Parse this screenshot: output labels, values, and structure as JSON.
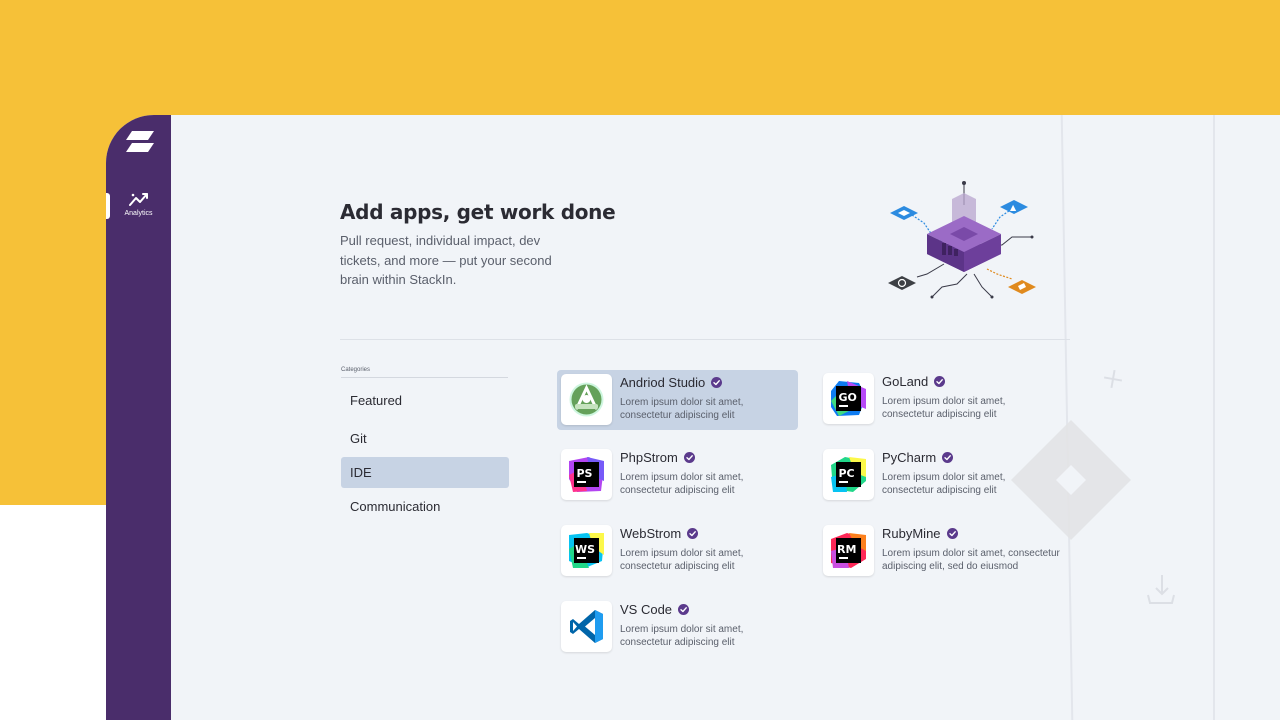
{
  "sidebar": {
    "nav": [
      {
        "label": "Analytics",
        "icon": "analytics-icon"
      }
    ]
  },
  "hero": {
    "title": "Add apps, get work done",
    "subtitle": "Pull request, individual impact, dev tickets, and more — put your second brain within StackIn."
  },
  "categories": {
    "label": "Categories",
    "items": [
      {
        "label": "Featured",
        "active": false
      },
      {
        "label": "Git",
        "active": false
      },
      {
        "label": "IDE",
        "active": true
      },
      {
        "label": "Communication",
        "active": false
      }
    ]
  },
  "apps": [
    {
      "name": "Andriod Studio",
      "desc": "Lorem ipsum dolor sit amet, consectetur adipiscing elit",
      "icon": "android-studio-icon",
      "active": true
    },
    {
      "name": "GoLand",
      "desc": "Lorem ipsum dolor sit amet, consectetur adipiscing elit",
      "icon": "goland-icon",
      "active": false
    },
    {
      "name": "PhpStrom",
      "desc": "Lorem ipsum dolor sit amet, consectetur adipiscing elit",
      "icon": "phpstorm-icon",
      "active": false
    },
    {
      "name": "PyCharm",
      "desc": "Lorem ipsum dolor sit amet, consectetur adipiscing elit",
      "icon": "pycharm-icon",
      "active": false
    },
    {
      "name": "WebStrom",
      "desc": "Lorem ipsum dolor sit amet, consectetur adipiscing elit",
      "icon": "webstorm-icon",
      "active": false
    },
    {
      "name": "RubyMine",
      "desc": "Lorem ipsum dolor sit amet, consectetur adipiscing elit, sed do eiusmod",
      "icon": "rubymine-icon",
      "active": false
    },
    {
      "name": "VS Code",
      "desc": "Lorem ipsum dolor sit amet, consectetur adipiscing elit",
      "icon": "vscode-icon",
      "active": false
    }
  ],
  "icon_texts": {
    "goland": "GO",
    "phpstorm": "PS",
    "pycharm": "PC",
    "webstorm": "WS",
    "rubymine": "RM"
  },
  "colors": {
    "brand_yellow": "#f6c138",
    "sidebar_purple": "#4a2d6b",
    "verified_purple": "#5b3a8c",
    "active_bg": "#c7d3e4"
  }
}
